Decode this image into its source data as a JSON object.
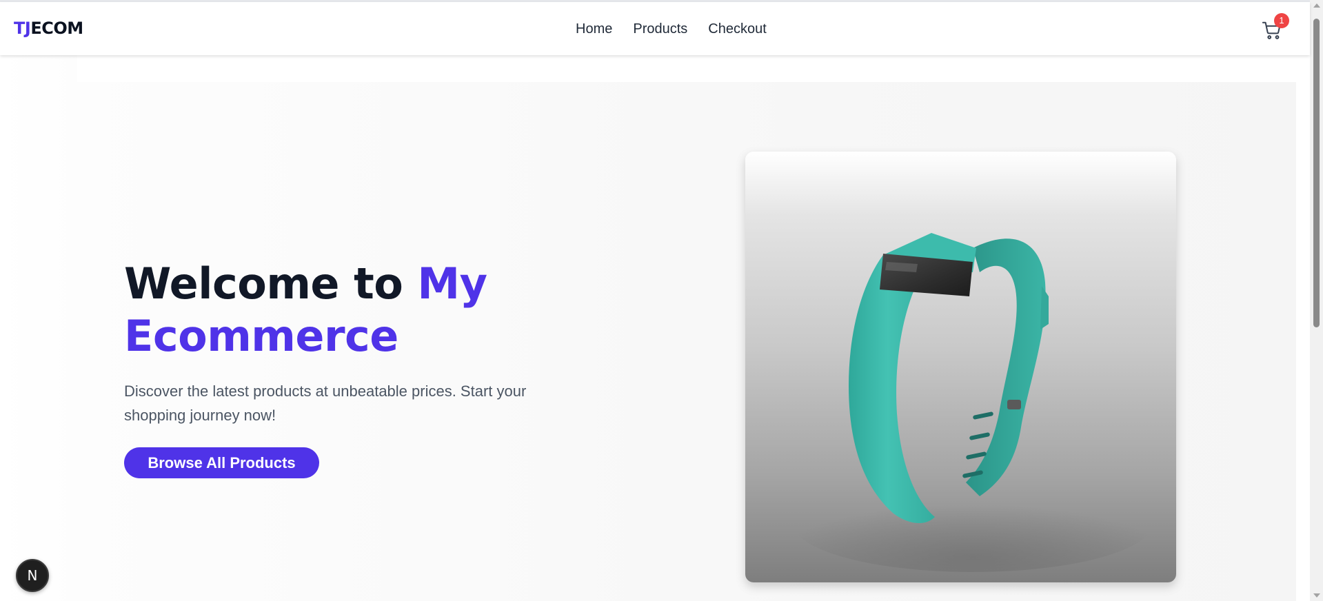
{
  "brand": {
    "logo_part1": "TJ",
    "logo_part2": "ECOM",
    "accent_color": "#4f33e8"
  },
  "nav": {
    "items": [
      {
        "label": "Home"
      },
      {
        "label": "Products"
      },
      {
        "label": "Checkout"
      }
    ]
  },
  "cart": {
    "icon": "cart-icon",
    "count": "1",
    "badge_color": "#ef4444"
  },
  "hero": {
    "title_line": "Welcome to ",
    "title_accent_1": "My",
    "title_accent_2": "Ecommerce",
    "description": "Discover the latest products at unbeatable prices. Start your shopping journey now!",
    "cta_label": "Browse All Products",
    "image": "fitness-tracker-wristband"
  },
  "dev_badge": {
    "label": "N"
  }
}
